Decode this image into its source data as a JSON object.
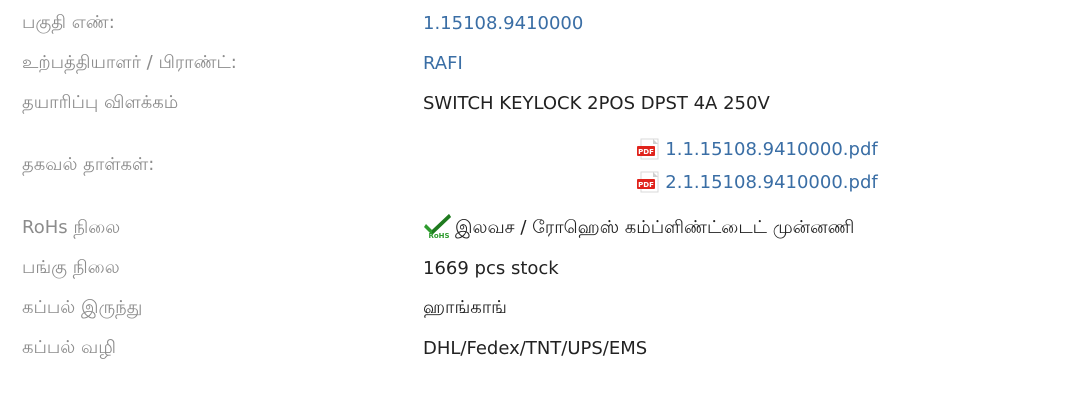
{
  "spec": {
    "part_number": {
      "label": "பகுதி எண்:",
      "value": "1.15108.9410000"
    },
    "manufacturer": {
      "label": "உற்பத்தியாளர் / பிராண்ட்:",
      "value": "RAFI"
    },
    "description": {
      "label": "தயாரிப்பு விளக்கம்",
      "value": "SWITCH KEYLOCK 2POS DPST 4A 250V"
    },
    "datasheets": {
      "label": "தகவல் தாள்கள்:",
      "files": [
        {
          "name": "1.1.15108.9410000.pdf",
          "icon": "pdf-icon"
        },
        {
          "name": "2.1.15108.9410000.pdf",
          "icon": "pdf-icon"
        }
      ]
    },
    "rohs": {
      "label": "RoHs நிலை",
      "value": "இலவச / ரோஹெஸ் கம்ப்ளிண்ட்டைட் முன்னணி",
      "icon": "rohs-check-icon"
    },
    "stock": {
      "label": "பங்கு நிலை",
      "value": "1669 pcs stock"
    },
    "ship_from": {
      "label": "கப்பல் இருந்து",
      "value": "ஹாங்காங்"
    },
    "ship_via": {
      "label": "கப்பல் வழி",
      "value": "DHL/Fedex/TNT/UPS/EMS"
    }
  },
  "colors": {
    "label": "#8c8c8c",
    "value": "#222222",
    "link": "#3a6ea5",
    "pdf_red": "#e0231c",
    "rohs_green": "#2e9b2e"
  }
}
